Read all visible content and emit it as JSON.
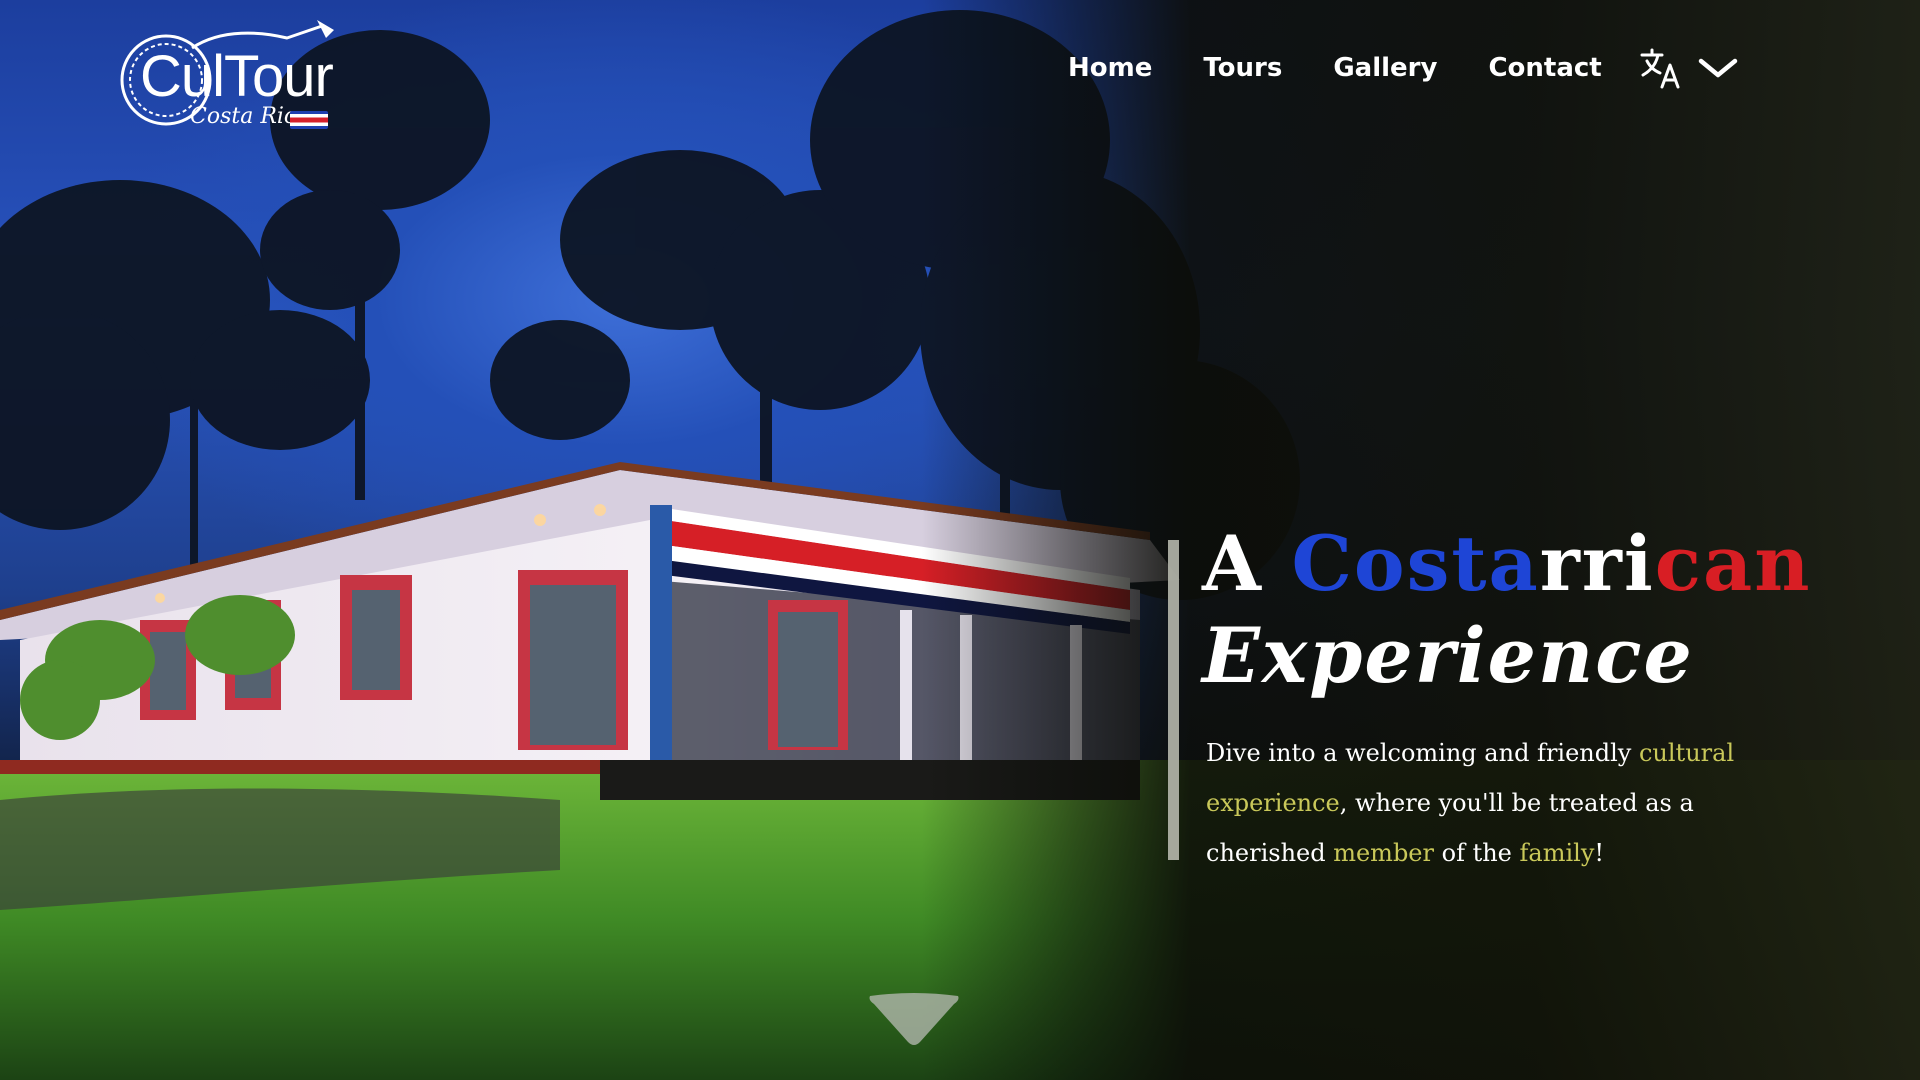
{
  "brand": {
    "name": "CulTour",
    "subtitle": "Costa Rica",
    "logo_icon": "guitar-logo-icon"
  },
  "nav": {
    "items": [
      {
        "label": "Home"
      },
      {
        "label": "Tours"
      },
      {
        "label": "Gallery"
      },
      {
        "label": "Contact"
      }
    ],
    "language_icon": "translate-icon",
    "language_dropdown_icon": "chevron-down-icon"
  },
  "hero": {
    "headline": {
      "word1": "A",
      "part_blue": "Costa",
      "part_white": "rri",
      "part_red": "can",
      "line2": "Experience"
    },
    "tagline": {
      "t1": "Dive into a welcoming and friendly ",
      "h1": "cultural experience",
      "t2": ", where you'll be treated as a cherished ",
      "h2": "member",
      "t3": " of the ",
      "h3": "family",
      "t4": "!"
    },
    "scroll_icon": "triangle-down-icon"
  },
  "colors": {
    "accent_blue": "#1e45d6",
    "accent_red": "#d81e24",
    "highlight": "#c9c85a",
    "text": "#ffffff",
    "dark_panel": "#101109"
  }
}
